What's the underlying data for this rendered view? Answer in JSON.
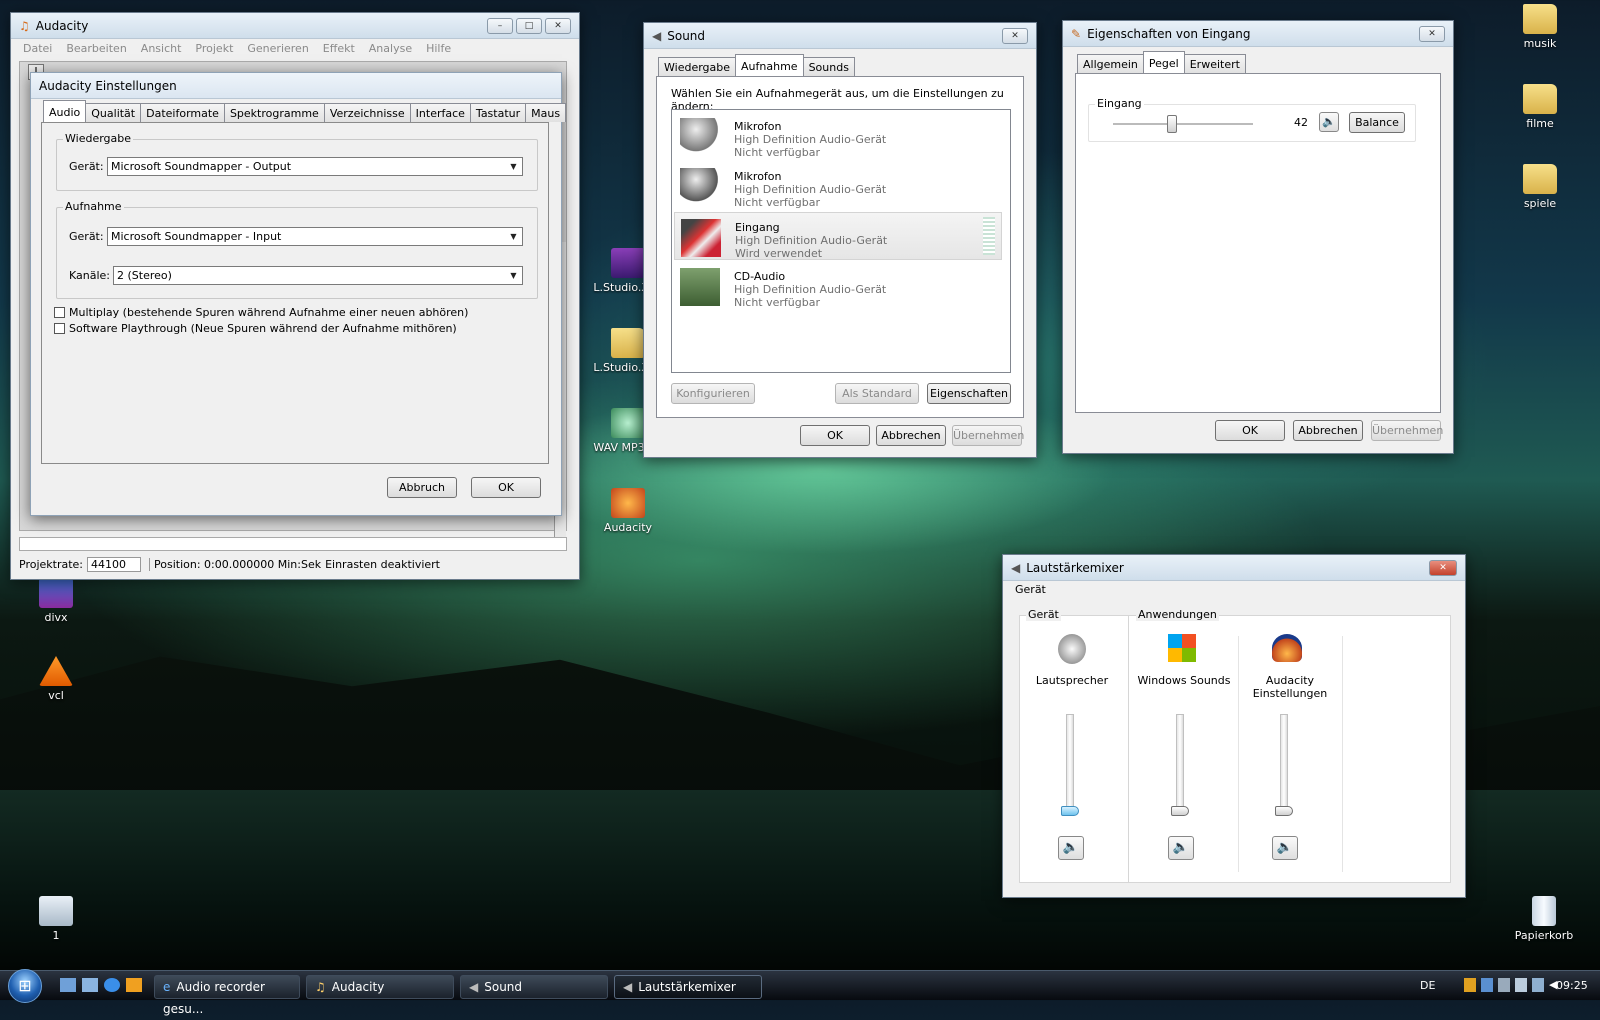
{
  "desktop": {
    "icons": [
      {
        "label": "musik",
        "type": "folder"
      },
      {
        "label": "filme",
        "type": "folder"
      },
      {
        "label": "spiele",
        "type": "folder"
      },
      {
        "label": "L.Studio.XXL",
        "type": "app"
      },
      {
        "label": "L.Studio.XXL",
        "type": "folder"
      },
      {
        "label": "WAV MP3 Co",
        "type": "app"
      },
      {
        "label": "Audacity",
        "type": "app"
      },
      {
        "label": "divx",
        "type": "app"
      },
      {
        "label": "vcl",
        "type": "app"
      },
      {
        "label": "1",
        "type": "app"
      },
      {
        "label": "Papierkorb",
        "type": "trash"
      }
    ]
  },
  "audacity": {
    "title": "Audacity",
    "menu": [
      "Datei",
      "Bearbeiten",
      "Ansicht",
      "Projekt",
      "Generieren",
      "Effekt",
      "Analyse",
      "Hilfe"
    ],
    "status": {
      "rate_label": "Projektrate:",
      "rate_value": "44100",
      "position": "Position: 0:00.000000 Min:Sek",
      "snap": "Einrasten deaktiviert"
    }
  },
  "settings": {
    "title": "Audacity Einstellungen",
    "tabs": [
      "Audio E/A",
      "Qualität",
      "Dateiformate",
      "Spektrogramme",
      "Verzeichnisse",
      "Interface",
      "Tastatur",
      "Maus"
    ],
    "playback": {
      "group": "Wiedergabe",
      "device_label": "Gerät:",
      "device": "Microsoft Soundmapper - Output"
    },
    "record": {
      "group": "Aufnahme",
      "device_label": "Gerät:",
      "device": "Microsoft Soundmapper - Input",
      "channels_label": "Kanäle:",
      "channels": "2 (Stereo)"
    },
    "multiplay": "Multiplay (bestehende Spuren während Aufnahme einer neuen abhören)",
    "playthrough": "Software Playthrough (Neue Spuren während der Aufnahme mithören)",
    "cancel": "Abbruch",
    "ok": "OK"
  },
  "sound": {
    "title": "Sound",
    "tabs": [
      "Wiedergabe",
      "Aufnahme",
      "Sounds"
    ],
    "instruction": "Wählen Sie ein Aufnahmegerät aus, um die Einstellungen zu ändern:",
    "devices": [
      {
        "name": "Mikrofon",
        "desc": "High Definition Audio-Gerät",
        "status": "Nicht verfügbar"
      },
      {
        "name": "Mikrofon",
        "desc": "High Definition Audio-Gerät",
        "status": "Nicht verfügbar"
      },
      {
        "name": "Eingang",
        "desc": "High Definition Audio-Gerät",
        "status": "Wird verwendet"
      },
      {
        "name": "CD-Audio",
        "desc": "High Definition Audio-Gerät",
        "status": "Nicht verfügbar"
      }
    ],
    "configure": "Konfigurieren",
    "set_default": "Als Standard",
    "properties": "Eigenschaften",
    "ok": "OK",
    "cancel": "Abbrechen",
    "apply": "Übernehmen"
  },
  "props": {
    "title": "Eigenschaften von Eingang",
    "tabs": [
      "Allgemein",
      "Pegel",
      "Erweitert"
    ],
    "level_label": "Eingang",
    "level_value": "42",
    "level_fraction": 0.42,
    "balance": "Balance",
    "ok": "OK",
    "cancel": "Abbrechen",
    "apply": "Übernehmen"
  },
  "mixer": {
    "title": "Lautstärkemixer",
    "menu": "Gerät",
    "device_group": "Gerät",
    "apps_group": "Anwendungen",
    "channels": [
      {
        "label": "Lautsprecher"
      },
      {
        "label": "Windows Sounds"
      },
      {
        "label": "Audacity Einstellungen"
      }
    ]
  },
  "taskbar": {
    "items": [
      "Audio recorder gesu...",
      "Audacity",
      "Sound",
      "Lautstärkemixer"
    ],
    "lang": "DE",
    "clock": "09:25"
  }
}
